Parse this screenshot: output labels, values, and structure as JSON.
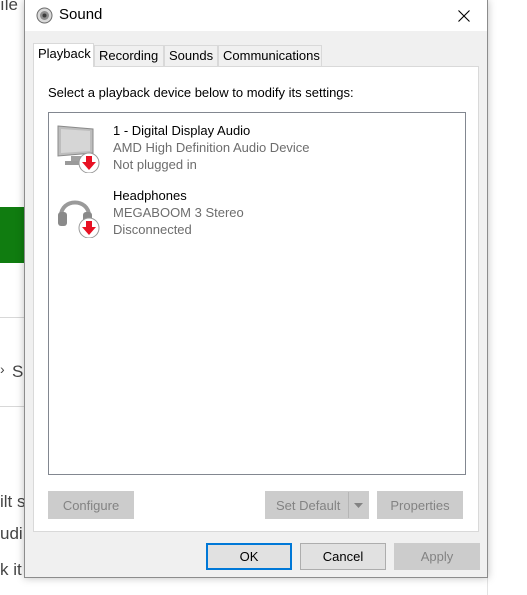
{
  "background": {
    "frag_top": "ıle",
    "frag_mid": "S",
    "frag_1": "ilt s",
    "frag_2": "udi",
    "frag_3": "k it"
  },
  "window": {
    "title": "Sound",
    "icon": "speaker-icon"
  },
  "tabs": [
    {
      "label": "Playback",
      "active": true
    },
    {
      "label": "Recording",
      "active": false
    },
    {
      "label": "Sounds",
      "active": false
    },
    {
      "label": "Communications",
      "active": false
    }
  ],
  "instruction": "Select a playback device below to modify its settings:",
  "devices": [
    {
      "name": "1 - Digital Display Audio",
      "driver": "AMD High Definition Audio Device",
      "status": "Not plugged in",
      "icon": "monitor-icon"
    },
    {
      "name": "Headphones",
      "driver": "MEGABOOM 3 Stereo",
      "status": "Disconnected",
      "icon": "headphones-icon"
    }
  ],
  "buttons": {
    "configure": "Configure",
    "set_default": "Set Default",
    "properties": "Properties",
    "ok": "OK",
    "cancel": "Cancel",
    "apply": "Apply"
  },
  "colors": {
    "accent": "#0078d7",
    "status_arrow": "#e81123",
    "background_green": "#107c10"
  }
}
